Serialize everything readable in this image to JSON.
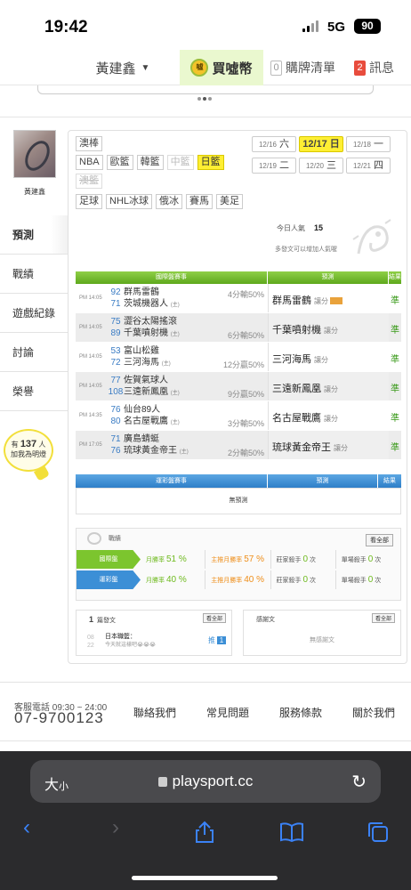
{
  "status": {
    "time": "19:42",
    "network": "5G",
    "battery": "90"
  },
  "nav": {
    "user": "黃建鑫",
    "buy_label": "買噓幣",
    "coin_text": "噓",
    "cart_count": "0",
    "cart_label": "購牌清單",
    "msg_count": "2",
    "msg_label": "訊息"
  },
  "profile": {
    "name": "黃建鑫"
  },
  "sidebar": {
    "items": [
      "預測",
      "戰績",
      "遊戲紀錄",
      "討論",
      "榮譽"
    ],
    "bulb": {
      "prefix": "有",
      "count": "137",
      "suffix": "人",
      "line2": "加我為明燈"
    }
  },
  "sports": {
    "row1": [
      "澳棒"
    ],
    "row2": [
      "NBA",
      "歐籃",
      "韓籃",
      "中籃",
      "日籃"
    ],
    "row3": [
      "澳籃"
    ],
    "row4": [
      "足球",
      "NHL冰球",
      "俄冰",
      "賽馬",
      "美足"
    ]
  },
  "dates": [
    {
      "d": "12/16",
      "w": "六"
    },
    {
      "d": "12/17",
      "w": "日"
    },
    {
      "d": "12/18",
      "w": "一"
    },
    {
      "d": "12/19",
      "w": "二"
    },
    {
      "d": "12/20",
      "w": "三"
    },
    {
      "d": "12/21",
      "w": "四"
    }
  ],
  "popularity": {
    "label": "今日人氣",
    "value": "15",
    "note": "多發文可以增加人氣喔"
  },
  "predict_table": {
    "headers": [
      "國際盤賽事",
      "預測",
      "結果"
    ],
    "rows": [
      {
        "time": "PM 14:05",
        "n1": "92",
        "t1": "群馬雷鶴",
        "m1": "",
        "n2": "71",
        "t2": "茨城機器人",
        "m2": "(主)",
        "line": "4分輸50%",
        "line_row": 1,
        "pick": "群馬雷鶴",
        "pick_note": "讓分",
        "result": "準"
      },
      {
        "time": "PM 14:05",
        "n1": "75",
        "t1": "澀谷太陽搖滾",
        "m1": "",
        "n2": "89",
        "t2": "千葉噴射機",
        "m2": "(主)",
        "line": "6分輸50%",
        "line_row": 2,
        "pick": "千葉噴射機",
        "pick_note": "讓分",
        "result": "準"
      },
      {
        "time": "PM 14:05",
        "n1": "53",
        "t1": "富山松雞",
        "m1": "",
        "n2": "72",
        "t2": "三河海馬",
        "m2": "(主)",
        "line": "12分贏50%",
        "line_row": 2,
        "pick": "三河海馬",
        "pick_note": "讓分",
        "result": "準"
      },
      {
        "time": "PM 14:05",
        "n1": "77",
        "t1": "佐賀氣球人",
        "m1": "",
        "n2": "108",
        "t2": "三遠新鳳凰",
        "m2": "(主)",
        "line": "9分贏50%",
        "line_row": 2,
        "pick": "三遠新鳳凰",
        "pick_note": "讓分",
        "result": "準"
      },
      {
        "time": "PM 14:35",
        "n1": "76",
        "t1": "仙台89人",
        "m1": "",
        "n2": "80",
        "t2": "名古屋戰鷹",
        "m2": "(主)",
        "line": "3分輸50%",
        "line_row": 2,
        "pick": "名古屋戰鷹",
        "pick_note": "讓分",
        "result": "準"
      },
      {
        "time": "PM 17:05",
        "n1": "71",
        "t1": "廣島蜻蜓",
        "m1": "",
        "n2": "76",
        "t2": "琉球黃金帝王",
        "m2": "(主)",
        "line": "2分輸50%",
        "line_row": 2,
        "pick": "琉球黃金帝王",
        "pick_note": "讓分",
        "result": "準"
      }
    ]
  },
  "lottery_table": {
    "headers": [
      "運彩盤賽事",
      "預測",
      "結果"
    ],
    "empty": "無預測"
  },
  "record": {
    "title": "戰績",
    "all": "看全部",
    "rows": [
      {
        "badge": "國際盤",
        "monthly_label": "月勝率",
        "monthly": "51 %",
        "main_label": "主推月勝率",
        "main": "57 %",
        "dealer_label": "莊家殺手",
        "dealer": "0",
        "single_label": "單場殺手",
        "single": "0",
        "unit": "次"
      },
      {
        "badge": "運彩盤",
        "monthly_label": "月勝率",
        "monthly": "40 %",
        "main_label": "主推月勝率",
        "main": "40 %",
        "dealer_label": "莊家殺手",
        "dealer": "0",
        "single_label": "單場殺手",
        "single": "0",
        "unit": "次"
      }
    ]
  },
  "posts": {
    "count": "1",
    "label": "篇發文",
    "all": "看全部",
    "item": {
      "month": "08",
      "day": "22",
      "title": "日本職籃：",
      "sub": "今天就這樣吧😭😭😭",
      "push_label": "推",
      "push_count": "1"
    }
  },
  "comments": {
    "label": "感謝文",
    "all": "看全部",
    "empty": "無感謝文"
  },
  "footer": {
    "hotline": "客服電話 09:30 ~ 24:00",
    "phone": "07-9700123",
    "links": [
      "聯絡我們",
      "常見問題",
      "服務條款",
      "關於我們"
    ]
  },
  "browser": {
    "aa": "大",
    "aa_small": "小",
    "url": "playsport.cc"
  }
}
